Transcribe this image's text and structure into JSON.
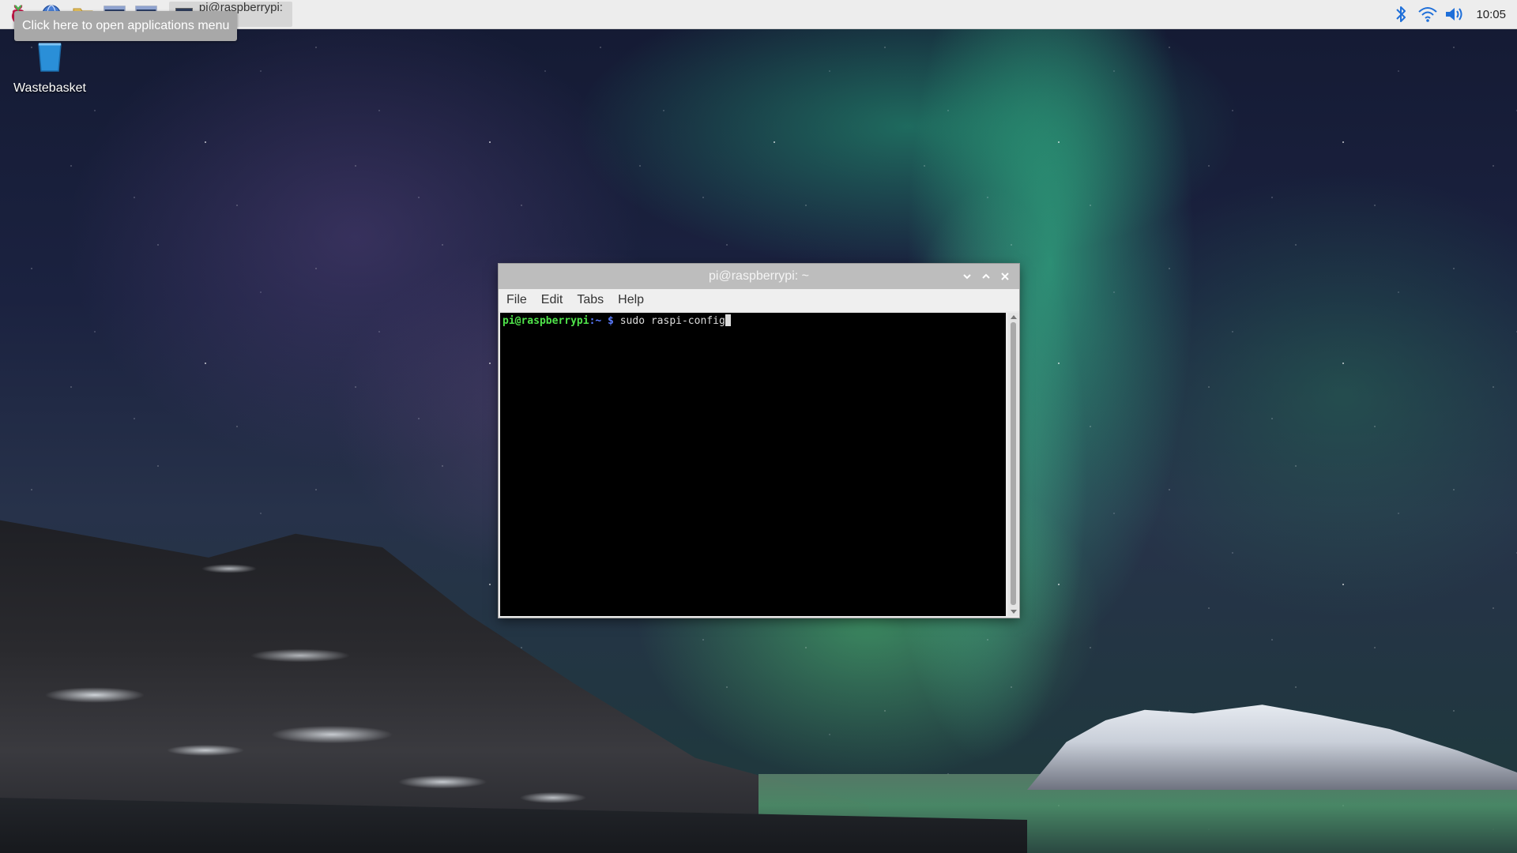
{
  "taskbar": {
    "launchers": [
      {
        "icon": "raspberry-menu-icon"
      },
      {
        "icon": "web-browser-icon"
      },
      {
        "icon": "file-manager-icon"
      },
      {
        "icon": "terminal-icon"
      },
      {
        "icon": "terminal-icon"
      }
    ],
    "active_window_title": "pi@raspberrypi: ~",
    "tray": {
      "bluetooth_icon": "bluetooth-icon",
      "wifi_icon": "wifi-icon",
      "volume_icon": "volume-icon",
      "clock": "10:05"
    }
  },
  "tooltip": {
    "text": "Click here to open applications menu"
  },
  "desktop": {
    "icons": [
      {
        "label": "Wastebasket",
        "icon": "wastebasket-icon"
      }
    ]
  },
  "terminal_window": {
    "title": "pi@raspberrypi: ~",
    "menu": [
      "File",
      "Edit",
      "Tabs",
      "Help"
    ],
    "prompt_user": "pi@raspberrypi",
    "prompt_path": ":~ $",
    "command": " sudo raspi-config"
  },
  "colors": {
    "panel_bg": "#ededed",
    "prompt_user": "#4fe34a",
    "prompt_path": "#5b7cff",
    "terminal_bg": "#000000"
  }
}
